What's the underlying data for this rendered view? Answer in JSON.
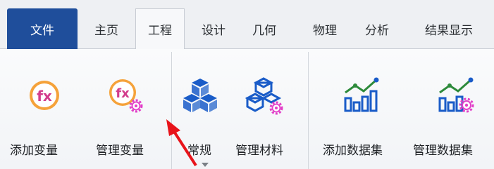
{
  "tabs": [
    "文件",
    "主页",
    "工程",
    "设计",
    "几何",
    "物理",
    "分析",
    "结果显示"
  ],
  "active_tab": "工程",
  "ribbon": {
    "buttons": [
      "添加变量",
      "管理变量",
      "常规",
      "管理材料",
      "添加数据集",
      "管理数据集"
    ]
  },
  "colors": {
    "file_tab": "#1f4e9b",
    "icon_blue": "#1a5cc8",
    "fx_orange": "#f5a23a",
    "gear_pink": "#e23fc8",
    "arrow_red": "#e8141b"
  }
}
